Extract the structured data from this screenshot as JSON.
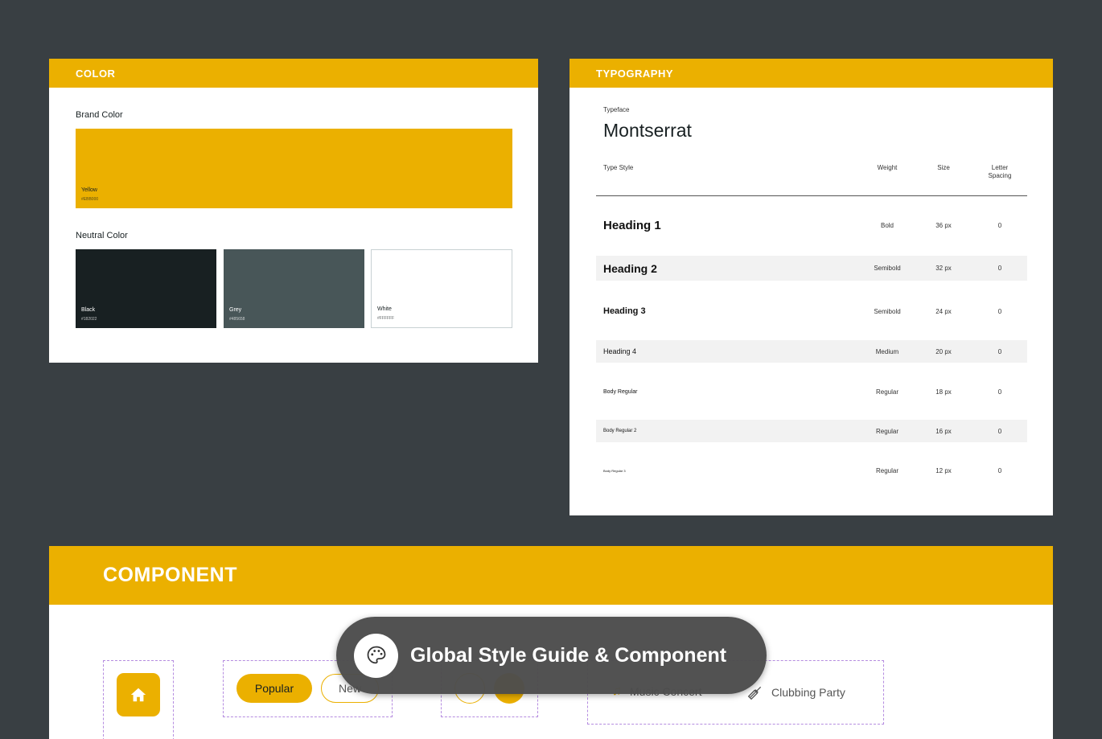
{
  "color": {
    "header": "COLOR",
    "brand_label": "Brand Color",
    "brand": {
      "name": "Yellow",
      "hex": "#EBB000"
    },
    "neutral_label": "Neutral Color",
    "neutrals": [
      {
        "name": "Black",
        "hex": "#182022",
        "swatch": "#182022"
      },
      {
        "name": "Grey",
        "hex": "#485658",
        "swatch": "#485658"
      },
      {
        "name": "White",
        "hex": "#FFFFFF",
        "swatch": "#FFFFFF"
      }
    ]
  },
  "typography": {
    "header": "TYPOGRAPHY",
    "typeface_label": "Typeface",
    "typeface": "Montserrat",
    "columns": {
      "style": "Type Style",
      "weight": "Weight",
      "size": "Size",
      "spacing": "Letter Spacing"
    },
    "rows": [
      {
        "name": "Heading 1",
        "weight": "Bold",
        "size": "36 px",
        "spacing": "0"
      },
      {
        "name": "Heading 2",
        "weight": "Semibold",
        "size": "32 px",
        "spacing": "0"
      },
      {
        "name": "Heading 3",
        "weight": "Semibold",
        "size": "24 px",
        "spacing": "0"
      },
      {
        "name": "Heading 4",
        "weight": "Medium",
        "size": "20 px",
        "spacing": "0"
      },
      {
        "name": "Body Regular",
        "weight": "Regular",
        "size": "18 px",
        "spacing": "0"
      },
      {
        "name": "Body Regular 2",
        "weight": "Regular",
        "size": "16 px",
        "spacing": "0"
      },
      {
        "name": "Body Regular 3",
        "weight": "Regular",
        "size": "12 px",
        "spacing": "0"
      }
    ]
  },
  "component": {
    "header": "COMPONENT",
    "pills": {
      "popular": "Popular",
      "new": "New"
    },
    "menu": {
      "music": "Music Concert",
      "clubbing": "Clubbing Party"
    }
  },
  "badge": {
    "text": "Global Style Guide & Component",
    "icon": "palette-icon"
  },
  "colors": {
    "accent": "#EBB000",
    "background": "#393F43",
    "dash": "#B58CE0"
  }
}
